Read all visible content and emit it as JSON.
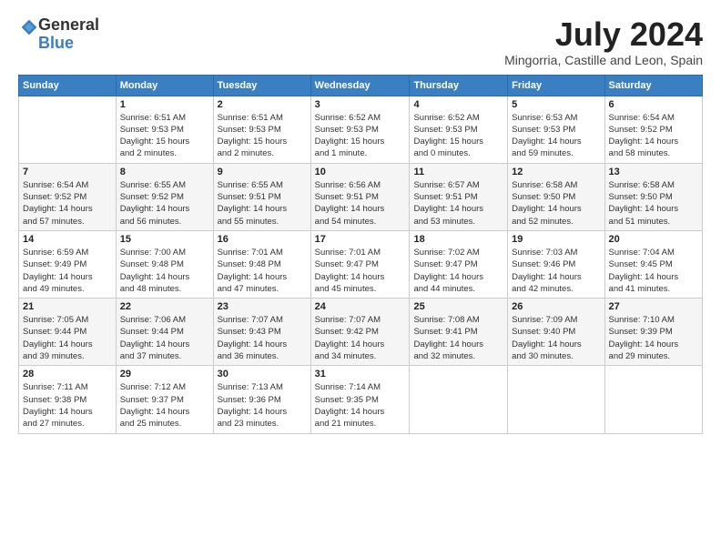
{
  "logo": {
    "general": "General",
    "blue": "Blue"
  },
  "title": "July 2024",
  "location": "Mingorria, Castille and Leon, Spain",
  "weekdays": [
    "Sunday",
    "Monday",
    "Tuesday",
    "Wednesday",
    "Thursday",
    "Friday",
    "Saturday"
  ],
  "weeks": [
    [
      {
        "day": "",
        "info": ""
      },
      {
        "day": "1",
        "info": "Sunrise: 6:51 AM\nSunset: 9:53 PM\nDaylight: 15 hours\nand 2 minutes."
      },
      {
        "day": "2",
        "info": "Sunrise: 6:51 AM\nSunset: 9:53 PM\nDaylight: 15 hours\nand 2 minutes."
      },
      {
        "day": "3",
        "info": "Sunrise: 6:52 AM\nSunset: 9:53 PM\nDaylight: 15 hours\nand 1 minute."
      },
      {
        "day": "4",
        "info": "Sunrise: 6:52 AM\nSunset: 9:53 PM\nDaylight: 15 hours\nand 0 minutes."
      },
      {
        "day": "5",
        "info": "Sunrise: 6:53 AM\nSunset: 9:53 PM\nDaylight: 14 hours\nand 59 minutes."
      },
      {
        "day": "6",
        "info": "Sunrise: 6:54 AM\nSunset: 9:52 PM\nDaylight: 14 hours\nand 58 minutes."
      }
    ],
    [
      {
        "day": "7",
        "info": "Sunrise: 6:54 AM\nSunset: 9:52 PM\nDaylight: 14 hours\nand 57 minutes."
      },
      {
        "day": "8",
        "info": "Sunrise: 6:55 AM\nSunset: 9:52 PM\nDaylight: 14 hours\nand 56 minutes."
      },
      {
        "day": "9",
        "info": "Sunrise: 6:55 AM\nSunset: 9:51 PM\nDaylight: 14 hours\nand 55 minutes."
      },
      {
        "day": "10",
        "info": "Sunrise: 6:56 AM\nSunset: 9:51 PM\nDaylight: 14 hours\nand 54 minutes."
      },
      {
        "day": "11",
        "info": "Sunrise: 6:57 AM\nSunset: 9:51 PM\nDaylight: 14 hours\nand 53 minutes."
      },
      {
        "day": "12",
        "info": "Sunrise: 6:58 AM\nSunset: 9:50 PM\nDaylight: 14 hours\nand 52 minutes."
      },
      {
        "day": "13",
        "info": "Sunrise: 6:58 AM\nSunset: 9:50 PM\nDaylight: 14 hours\nand 51 minutes."
      }
    ],
    [
      {
        "day": "14",
        "info": "Sunrise: 6:59 AM\nSunset: 9:49 PM\nDaylight: 14 hours\nand 49 minutes."
      },
      {
        "day": "15",
        "info": "Sunrise: 7:00 AM\nSunset: 9:48 PM\nDaylight: 14 hours\nand 48 minutes."
      },
      {
        "day": "16",
        "info": "Sunrise: 7:01 AM\nSunset: 9:48 PM\nDaylight: 14 hours\nand 47 minutes."
      },
      {
        "day": "17",
        "info": "Sunrise: 7:01 AM\nSunset: 9:47 PM\nDaylight: 14 hours\nand 45 minutes."
      },
      {
        "day": "18",
        "info": "Sunrise: 7:02 AM\nSunset: 9:47 PM\nDaylight: 14 hours\nand 44 minutes."
      },
      {
        "day": "19",
        "info": "Sunrise: 7:03 AM\nSunset: 9:46 PM\nDaylight: 14 hours\nand 42 minutes."
      },
      {
        "day": "20",
        "info": "Sunrise: 7:04 AM\nSunset: 9:45 PM\nDaylight: 14 hours\nand 41 minutes."
      }
    ],
    [
      {
        "day": "21",
        "info": "Sunrise: 7:05 AM\nSunset: 9:44 PM\nDaylight: 14 hours\nand 39 minutes."
      },
      {
        "day": "22",
        "info": "Sunrise: 7:06 AM\nSunset: 9:44 PM\nDaylight: 14 hours\nand 37 minutes."
      },
      {
        "day": "23",
        "info": "Sunrise: 7:07 AM\nSunset: 9:43 PM\nDaylight: 14 hours\nand 36 minutes."
      },
      {
        "day": "24",
        "info": "Sunrise: 7:07 AM\nSunset: 9:42 PM\nDaylight: 14 hours\nand 34 minutes."
      },
      {
        "day": "25",
        "info": "Sunrise: 7:08 AM\nSunset: 9:41 PM\nDaylight: 14 hours\nand 32 minutes."
      },
      {
        "day": "26",
        "info": "Sunrise: 7:09 AM\nSunset: 9:40 PM\nDaylight: 14 hours\nand 30 minutes."
      },
      {
        "day": "27",
        "info": "Sunrise: 7:10 AM\nSunset: 9:39 PM\nDaylight: 14 hours\nand 29 minutes."
      }
    ],
    [
      {
        "day": "28",
        "info": "Sunrise: 7:11 AM\nSunset: 9:38 PM\nDaylight: 14 hours\nand 27 minutes."
      },
      {
        "day": "29",
        "info": "Sunrise: 7:12 AM\nSunset: 9:37 PM\nDaylight: 14 hours\nand 25 minutes."
      },
      {
        "day": "30",
        "info": "Sunrise: 7:13 AM\nSunset: 9:36 PM\nDaylight: 14 hours\nand 23 minutes."
      },
      {
        "day": "31",
        "info": "Sunrise: 7:14 AM\nSunset: 9:35 PM\nDaylight: 14 hours\nand 21 minutes."
      },
      {
        "day": "",
        "info": ""
      },
      {
        "day": "",
        "info": ""
      },
      {
        "day": "",
        "info": ""
      }
    ]
  ]
}
